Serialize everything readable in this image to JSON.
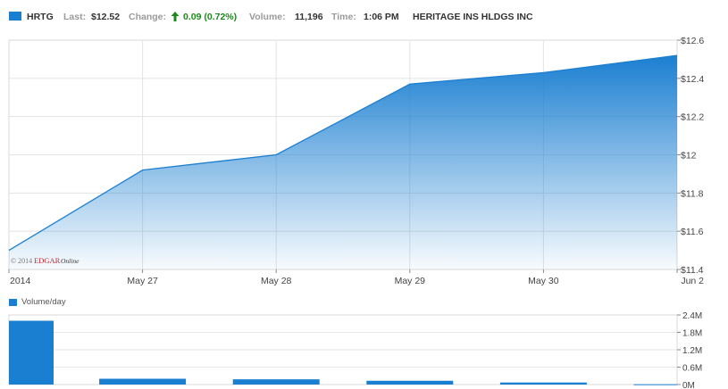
{
  "header": {
    "symbol": "HRTG",
    "last_label": "Last:",
    "last_value": "$12.52",
    "change_label": "Change:",
    "change_arrow": "up-arrow-icon",
    "change_value": "0.09 (0.72%)",
    "volume_label": "Volume:",
    "volume_value": "11,196",
    "time_label": "Time:",
    "time_value": "1:06 PM",
    "company": "HERITAGE INS HLDGS INC"
  },
  "volume_legend": "Volume/day",
  "watermark": {
    "copyright": "© 2014",
    "brand": "EDGAR",
    "brand_suffix": "Online"
  },
  "colors": {
    "series": "#1b7fd1",
    "positive_change": "#1e8a1e"
  },
  "chart_data": [
    {
      "type": "area",
      "x": [
        "2014",
        "May 27",
        "May 28",
        "May 29",
        "May 30",
        "Jun 2"
      ],
      "values": [
        11.5,
        11.92,
        12.0,
        12.37,
        12.43,
        12.52
      ],
      "ylim": [
        11.4,
        12.6
      ],
      "yticks": [
        "$11.4",
        "$11.6",
        "$11.8",
        "$12",
        "$12.2",
        "$12.4",
        "$12.6"
      ],
      "ytick_values": [
        11.4,
        11.6,
        11.8,
        12.0,
        12.2,
        12.4,
        12.6
      ],
      "xticks": [
        "2014",
        "May 27",
        "May 28",
        "May 29",
        "May 30",
        "Jun 2"
      ],
      "grid": true,
      "y_axis_side": "right"
    },
    {
      "type": "bar",
      "categories": [
        "2014",
        "May 27",
        "May 28",
        "May 29",
        "May 30",
        "Jun 2"
      ],
      "values": [
        2.2,
        0.2,
        0.18,
        0.13,
        0.07,
        0.01
      ],
      "unit": "M",
      "ylim": [
        0,
        2.4
      ],
      "yticks": [
        "0M",
        "0.6M",
        "1.2M",
        "1.8M",
        "2.4M"
      ],
      "ytick_values": [
        0,
        0.6,
        1.2,
        1.8,
        2.4
      ],
      "grid": true,
      "y_axis_side": "right"
    }
  ]
}
